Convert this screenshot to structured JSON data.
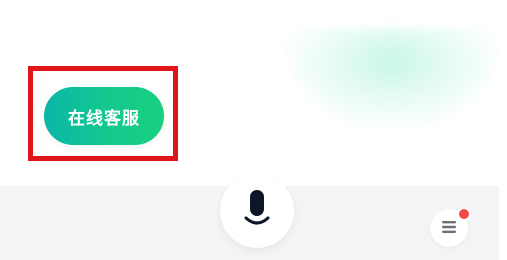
{
  "main": {
    "service_label": "在线客服"
  },
  "bottom_bar": {
    "mic_icon": "microphone-icon",
    "menu_icon": "menu-icon",
    "notification": "red-dot"
  },
  "colors": {
    "button_gradient_start": "#0bb6a6",
    "button_gradient_end": "#18d07e",
    "highlight_border": "#e0161b",
    "notify_dot": "#f24949",
    "bar_background": "#f4f4f6"
  }
}
